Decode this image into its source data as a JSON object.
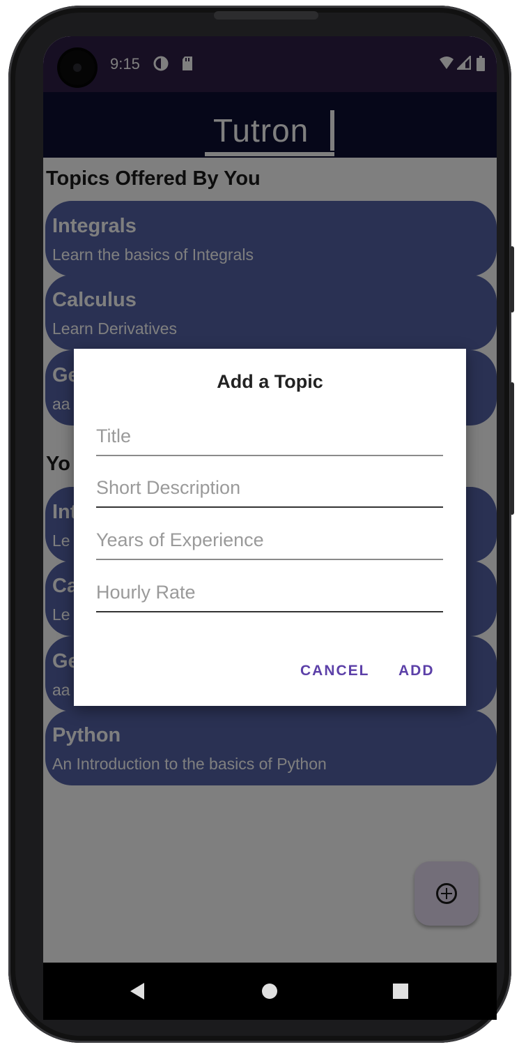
{
  "status_bar": {
    "time": "9:15",
    "icons": [
      "data-saver-icon",
      "sd-card-icon",
      "wifi-icon",
      "signal-icon",
      "battery-icon"
    ]
  },
  "app_bar": {
    "logo_text": "Tutron"
  },
  "sections": [
    {
      "title": "Topics Offered By You",
      "cards": [
        {
          "title": "Integrals",
          "description": "Learn the basics of Integrals"
        },
        {
          "title": "Calculus",
          "description": "Learn Derivatives"
        },
        {
          "title": "Ge",
          "description": "aa"
        }
      ]
    },
    {
      "title": "Yo",
      "cards": [
        {
          "title": "Int",
          "description": "Le"
        },
        {
          "title": "Ca",
          "description": "Le"
        },
        {
          "title": "Ge",
          "description": "aa"
        },
        {
          "title": "Python",
          "description": "An Introduction to the basics of Python"
        }
      ]
    }
  ],
  "dialog": {
    "title": "Add a Topic",
    "fields": [
      {
        "placeholder": "Title",
        "value": ""
      },
      {
        "placeholder": "Short Description",
        "value": ""
      },
      {
        "placeholder": "Years of Experience",
        "value": ""
      },
      {
        "placeholder": "Hourly Rate",
        "value": ""
      }
    ],
    "cancel_label": "CANCEL",
    "add_label": "ADD"
  },
  "fab": {
    "icon": "add-circle-icon"
  },
  "colors": {
    "status_bar": "#2e1f46",
    "app_bar": "#0d0e33",
    "card": "#5562a6",
    "accent": "#5c40a8",
    "fab": "#e6dcf3"
  }
}
